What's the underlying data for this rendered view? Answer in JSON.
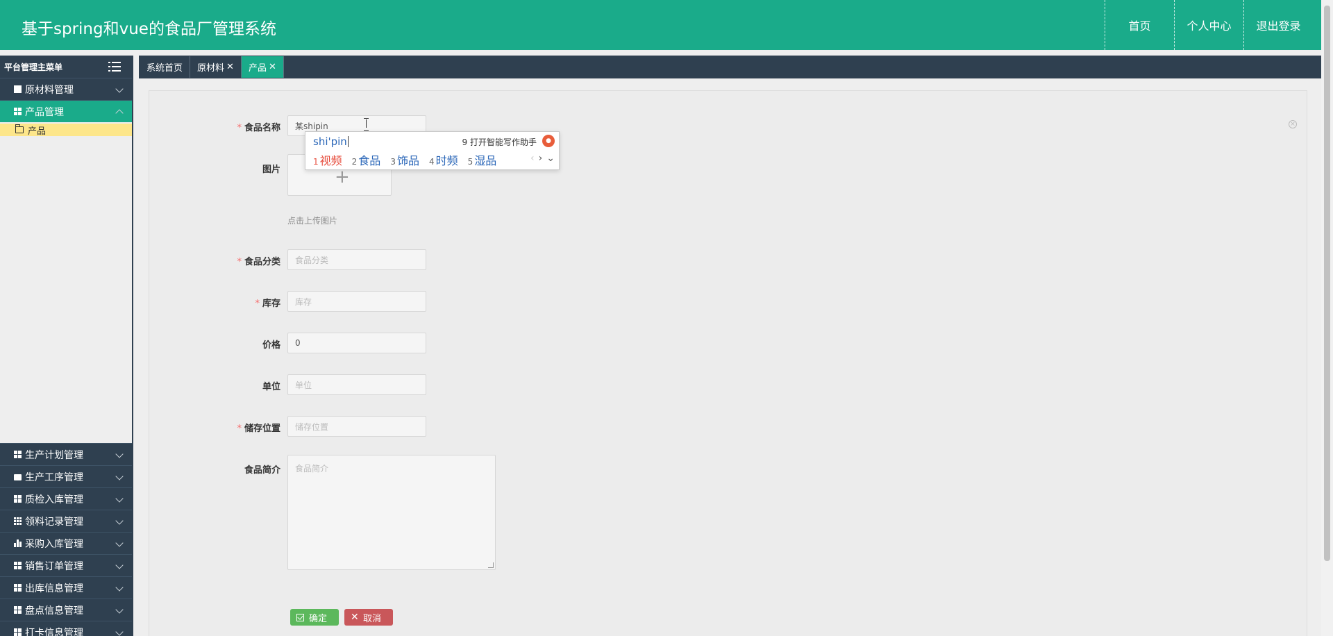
{
  "header": {
    "title": "基于spring和vue的食品厂管理系统",
    "nav": [
      "首页",
      "个人中心",
      "退出登录"
    ]
  },
  "sidebar": {
    "heading": "平台管理主菜单",
    "top_groups": [
      {
        "label": "原材料管理",
        "icon": "book-icon"
      },
      {
        "label": "产品管理",
        "icon": "grid-icon",
        "active": true
      }
    ],
    "sub_items": [
      {
        "label": "产品",
        "icon": "folder-icon"
      }
    ],
    "bottom_groups": [
      {
        "label": "生产计划管理",
        "icon": "grid-icon"
      },
      {
        "label": "生产工序管理",
        "icon": "briefcase-icon"
      },
      {
        "label": "质检入库管理",
        "icon": "grid-icon"
      },
      {
        "label": "领料记录管理",
        "icon": "table-icon"
      },
      {
        "label": "采购入库管理",
        "icon": "bar-chart-icon"
      },
      {
        "label": "销售订单管理",
        "icon": "grid-icon"
      },
      {
        "label": "出库信息管理",
        "icon": "grid-icon"
      },
      {
        "label": "盘点信息管理",
        "icon": "grid-icon"
      },
      {
        "label": "打卡信息管理",
        "icon": "grid-icon"
      }
    ]
  },
  "tabs": [
    {
      "label": "系统首页",
      "closable": false,
      "active": false
    },
    {
      "label": "原材料",
      "closable": true,
      "active": false
    },
    {
      "label": "产品",
      "closable": true,
      "active": true
    }
  ],
  "tab_close_glyph": "✕",
  "form": {
    "name": {
      "label": "食品名称",
      "required": true,
      "value": "某shipin"
    },
    "image": {
      "label": "图片",
      "hint": "点击上传图片",
      "icon": "plus-icon"
    },
    "category": {
      "label": "食品分类",
      "required": true,
      "placeholder": "食品分类"
    },
    "stock": {
      "label": "库存",
      "required": true,
      "placeholder": "库存"
    },
    "price": {
      "label": "价格",
      "required": false,
      "value": "0"
    },
    "unit": {
      "label": "单位",
      "required": false,
      "placeholder": "单位"
    },
    "location": {
      "label": "储存位置",
      "required": true,
      "placeholder": "储存位置"
    },
    "intro": {
      "label": "食品简介",
      "required": false,
      "placeholder": "食品简介"
    },
    "required_mark": "*"
  },
  "buttons": {
    "confirm": "确定",
    "cancel": "取消"
  },
  "ime": {
    "composition": "shi'pin",
    "assistant": "9 打开智能写作助手",
    "candidates": [
      {
        "n": "1",
        "text": "视频"
      },
      {
        "n": "2",
        "text": "食品"
      },
      {
        "n": "3",
        "text": "饰品"
      },
      {
        "n": "4",
        "text": "时频"
      },
      {
        "n": "5",
        "text": "湿品"
      }
    ]
  },
  "colors": {
    "primary": "#1aab8a",
    "dark": "#2f4050",
    "highlight": "#fde68a",
    "confirm": "#5cb85c",
    "cancel": "#c9575a"
  }
}
